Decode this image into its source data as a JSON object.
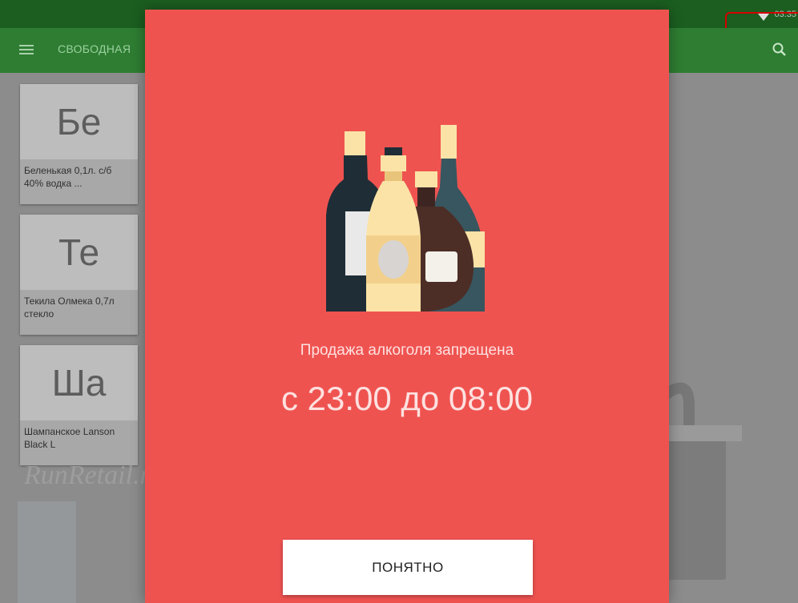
{
  "status_bar": {
    "time": "03:35"
  },
  "toolbar": {
    "title": "СВОБОДНАЯ"
  },
  "products": [
    {
      "abbr": "Бе",
      "name": "Беленькая 0,1л. с/б 40% водка ..."
    },
    {
      "abbr": "Те",
      "name": "Текила Олмека 0,7л стекло"
    },
    {
      "abbr": "Ша",
      "name": "Шампанское Lanson Black L"
    }
  ],
  "watermark": "RunRetail.ru",
  "dialog": {
    "message": "Продажа алкоголя запрещена",
    "time_range": "с 23:00 до 08:00",
    "button_label": "ПОНЯТНО",
    "background_color": "#ef5350",
    "illustration": "alcohol-bottles-icon"
  },
  "colors": {
    "status_bar": "#1b5e20",
    "toolbar": "#2e7d32"
  }
}
